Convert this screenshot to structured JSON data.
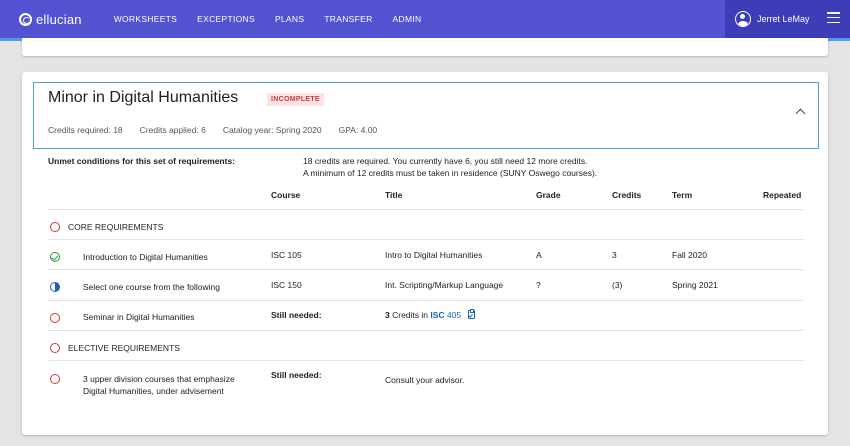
{
  "nav": {
    "brand": "ellucian",
    "links": [
      "WORKSHEETS",
      "EXCEPTIONS",
      "PLANS",
      "TRANSFER",
      "ADMIN"
    ],
    "user_name": "Jerret LeMay"
  },
  "block": {
    "title": "Minor in Digital Humanities",
    "status": "INCOMPLETE",
    "meta": {
      "credits_required": "Credits required:  18",
      "credits_applied": "Credits applied:  6",
      "catalog_year": "Catalog year:  Spring 2020",
      "gpa": "GPA:  4.00"
    },
    "unmet_label": "Unmet conditions for this set of requirements:",
    "unmet_lines": [
      "18 credits are required. You currently have 6, you still need 12 more credits.",
      "A minimum of 12 credits must be taken in residence (SUNY Oswego courses)."
    ],
    "columns": [
      "Course",
      "Title",
      "Grade",
      "Credits",
      "Term",
      "Repeated"
    ]
  },
  "rows": {
    "core": {
      "label": "CORE REQUIREMENTS",
      "status": "open"
    },
    "intro": {
      "label": "Introduction to Digital Humanities",
      "status": "done",
      "course": "ISC 105",
      "title": "Intro to Digital Humanities",
      "grade": "A",
      "credits": "3",
      "term": "Fall 2020"
    },
    "select": {
      "label": "Select one course from the following",
      "status": "in-progress",
      "course": "ISC 150",
      "title": "Int. Scripting/Markup Language",
      "grade": "?",
      "credits": "(3)",
      "term": "Spring 2021"
    },
    "seminar": {
      "label": "Seminar in Digital Humanities",
      "status": "open",
      "still_needed": "Still needed:",
      "need_count": "3",
      "need_mid": "Credits in",
      "need_course": "ISC",
      "need_number": "405"
    },
    "elective": {
      "label": "ELECTIVE REQUIREMENTS",
      "status": "open"
    },
    "upper": {
      "label_line1": "3 upper division courses that emphasize",
      "label_line2": "Digital Humanities, under advisement",
      "status": "open",
      "still_needed": "Still needed:",
      "advice": "Consult your advisor."
    }
  },
  "colors": {
    "nav": "#5353d1",
    "nav_user": "#3d3db8",
    "accent": "#4fa3dc",
    "link": "#1f62b3",
    "incomplete": "#d23a3a",
    "complete": "#2b9a3a"
  }
}
